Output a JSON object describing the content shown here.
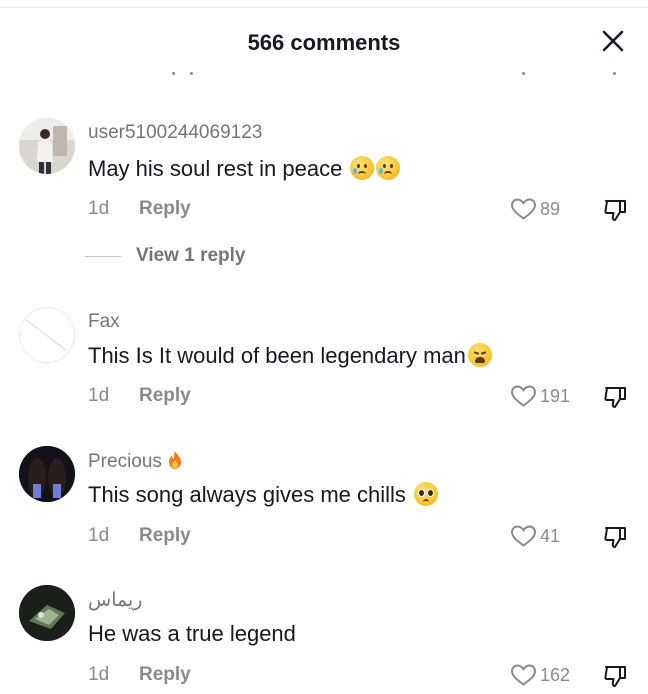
{
  "header": {
    "title": "566 comments"
  },
  "comments": [
    {
      "username": "user5100244069123",
      "text": "May his soul rest in peace",
      "time": "1d",
      "reply_label": "Reply",
      "likes": "89",
      "view_replies": "View 1 reply",
      "emoji": [
        "sad-tear-emoji",
        "sad-tear-emoji"
      ]
    },
    {
      "username": "Fax",
      "text": "This Is It would of been legendary man",
      "time": "1d",
      "reply_label": "Reply",
      "likes": "191",
      "emoji": [
        "weary-face-emoji"
      ]
    },
    {
      "username": "Precious",
      "text": "This song always gives me chills",
      "time": "1d",
      "reply_label": "Reply",
      "likes": "41",
      "emoji": [
        "pleading-face-emoji"
      ],
      "username_emoji": "fire-emoji"
    },
    {
      "username": "ريماس",
      "text": "He was a true legend",
      "time": "1d",
      "reply_label": "Reply",
      "likes": "162"
    }
  ],
  "colors": {
    "text": "#161823",
    "muted": "#8a8a8a",
    "username": "#757575"
  }
}
